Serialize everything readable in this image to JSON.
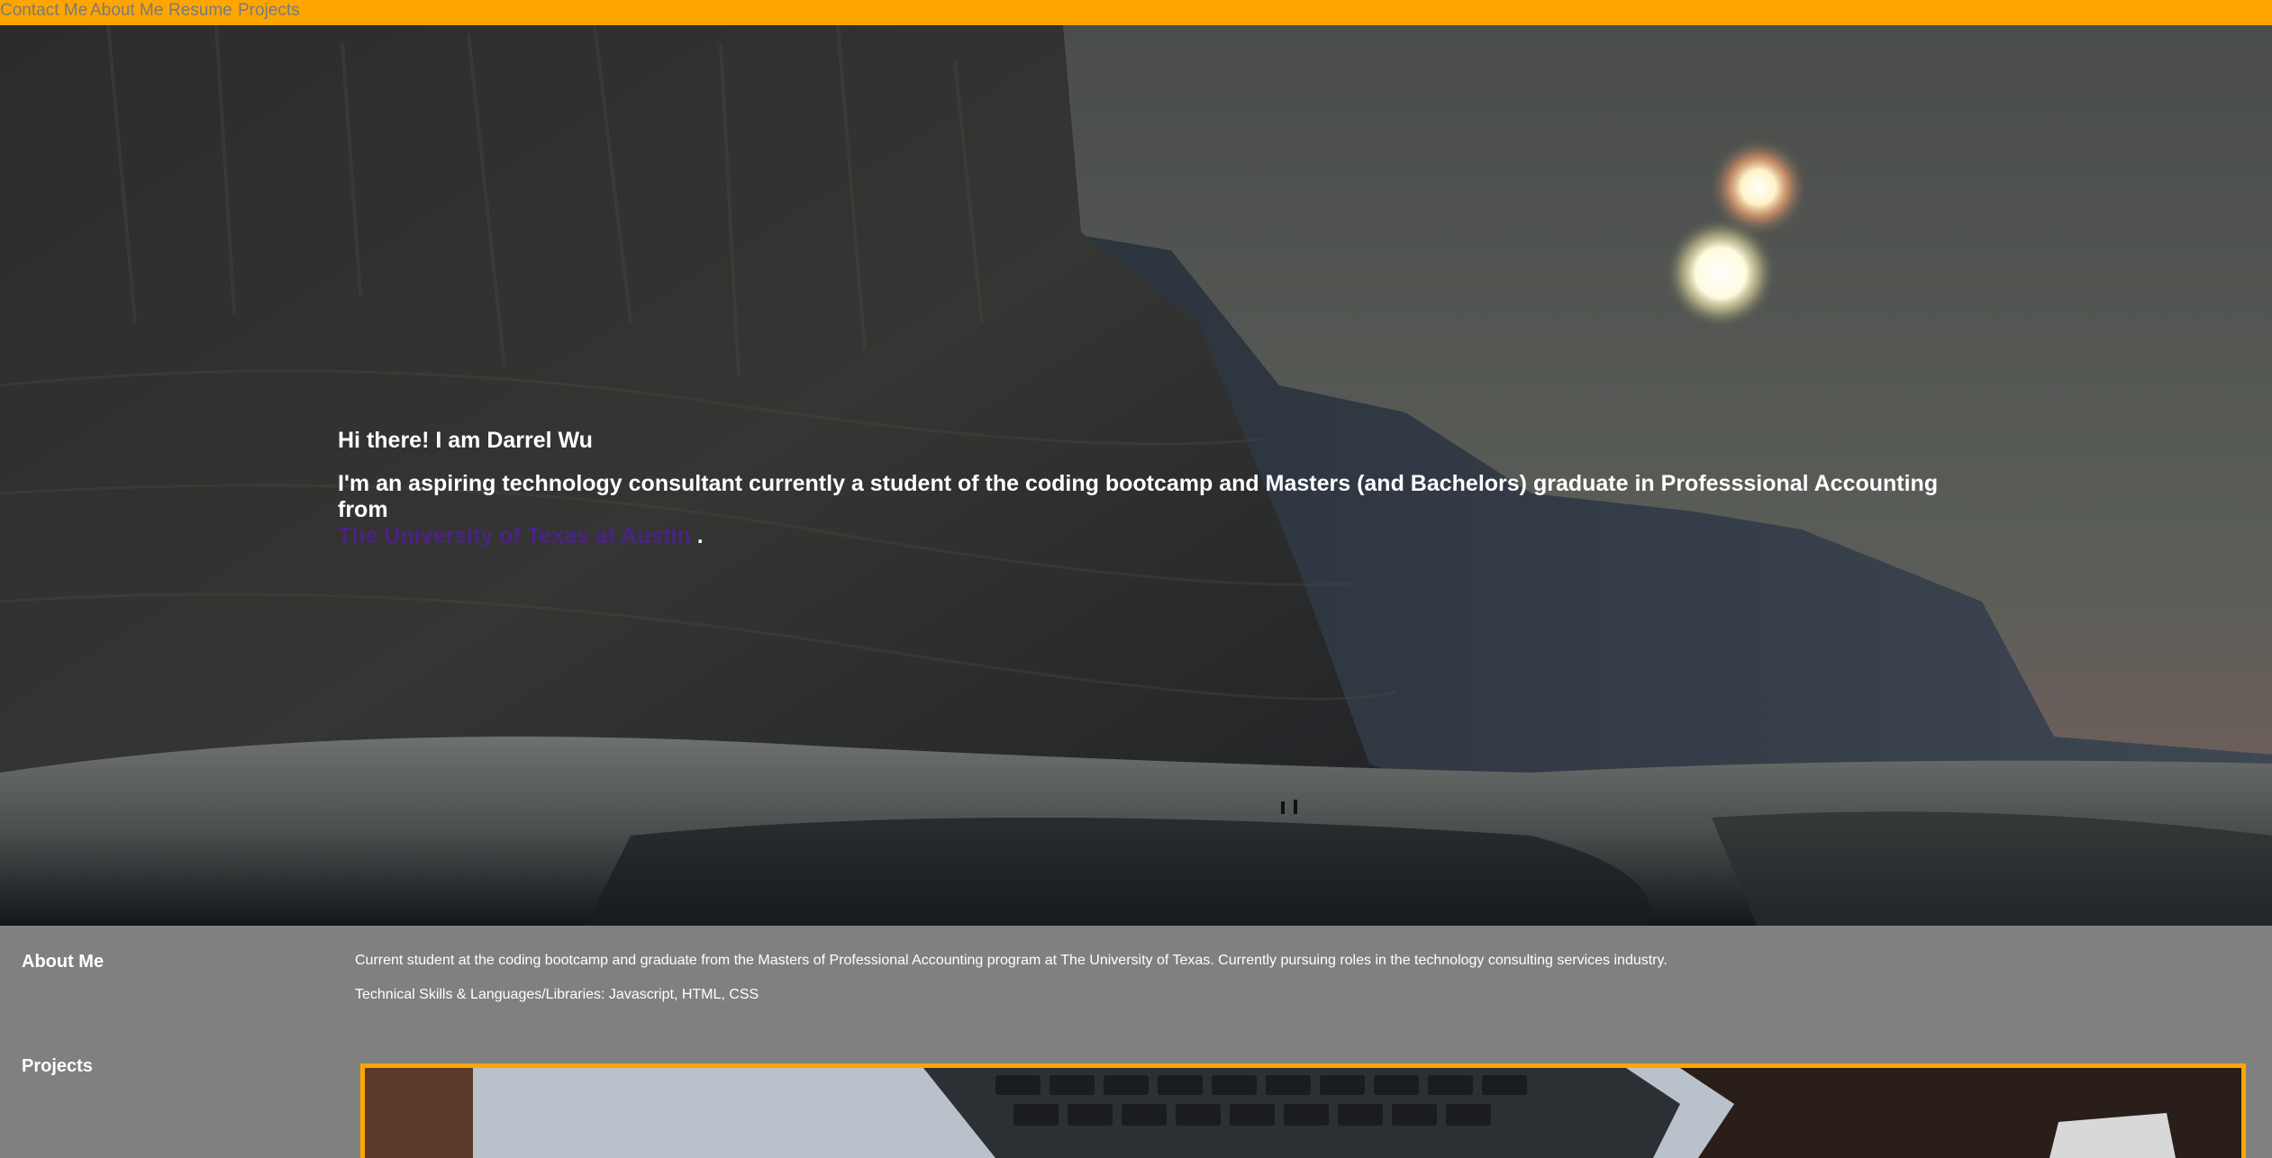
{
  "nav": {
    "items": [
      {
        "label": "Contact Me"
      },
      {
        "label": "About Me"
      },
      {
        "label": "Resume"
      },
      {
        "label": "Projects"
      }
    ]
  },
  "hero": {
    "greeting": "Hi there! I am Darrel Wu",
    "bio_text": "I'm an aspiring technology consultant currently a student of the coding bootcamp and Masters (and Bachelors) graduate in Professsional Accounting from",
    "bio_link": "The University of Texas at Austin",
    "bio_end": "."
  },
  "about": {
    "title": "About Me",
    "paragraph1": "Current student at the coding bootcamp and graduate from the Masters of Professional Accounting program at The University of Texas. Currently pursuing roles in the technology consulting services industry.",
    "paragraph2": "Technical Skills & Languages/Libraries: Javascript, HTML, CSS"
  },
  "projects": {
    "title": "Projects"
  },
  "colors": {
    "nav_bar": "#FFA500",
    "nav_text": "#7a7a7a",
    "page_background": "#808080",
    "link": "#4B2382",
    "project_border": "#FFA500"
  }
}
